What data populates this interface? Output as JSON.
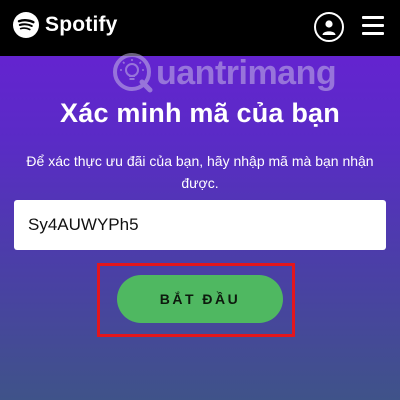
{
  "header": {
    "brand": "Spotify",
    "icons": {
      "logo": "spotify-logo-icon",
      "profile": "user-profile-icon",
      "menu": "hamburger-menu-icon"
    }
  },
  "watermark": {
    "text": "uantrimang",
    "icon": "lightbulb-q-icon"
  },
  "main": {
    "title": "Xác minh mã của bạn",
    "subtitle": "Để xác thực ưu đãi của bạn, hãy nhập mã mà bạn nhận được.",
    "code_value": "Sy4AUWYPh5",
    "start_label": "BẮT ĐẦU"
  },
  "colors": {
    "accent_green": "#4fb861",
    "header_bg": "#000000",
    "highlight_red": "#e3161d",
    "gradient_top": "#6a1fd6",
    "gradient_bottom": "#3f5389"
  }
}
